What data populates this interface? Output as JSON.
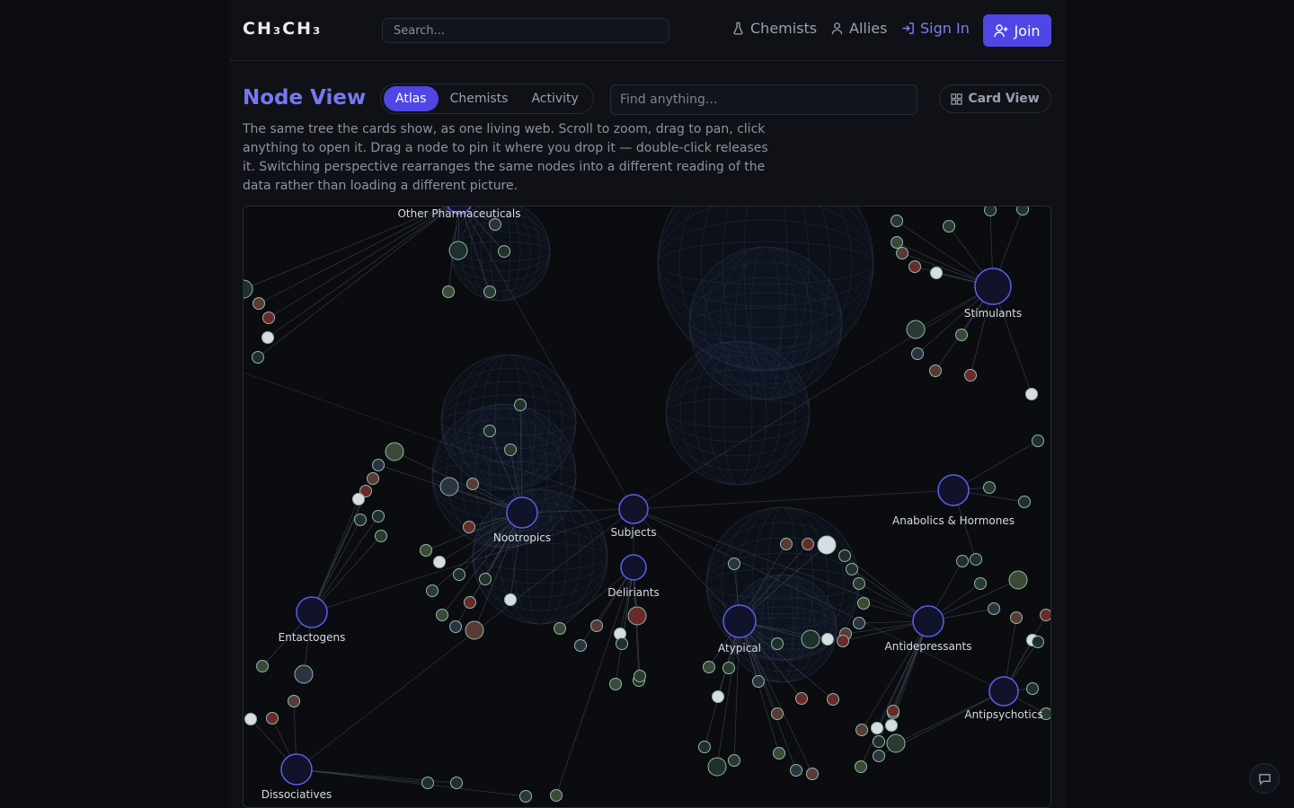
{
  "header": {
    "logo": "CH₃CH₃",
    "search_placeholder": "Search...",
    "nav": {
      "chemists": "Chemists",
      "allies": "Allies",
      "sign_in": "Sign In",
      "join": "Join"
    }
  },
  "page": {
    "title": "Node View",
    "tabs": [
      {
        "label": "Atlas",
        "active": true
      },
      {
        "label": "Chemists",
        "active": false
      },
      {
        "label": "Activity",
        "active": false
      }
    ],
    "find_placeholder": "Find anything...",
    "card_view_label": "Card View",
    "description": "The same tree the cards show, as one living web. Scroll to zoom, drag to pan, click anything to open it. Drag a node to pin it where you drop it — double-click releases it. Switching perspective rearranges the same nodes into a different reading of the data rather than loading a different picture."
  },
  "graph": {
    "colors": {
      "hub_ring": "#5b5ff0",
      "leaf_ring": "#8fb8a8",
      "edge": "#4a4f5e",
      "accent": "#7577f2"
    },
    "hubs": [
      {
        "label": "Other Pharmaceuticals"
      },
      {
        "label": "Stimulants"
      },
      {
        "label": "Anabolics & Hormones"
      },
      {
        "label": "Nootropics"
      },
      {
        "label": "Subjects"
      },
      {
        "label": "Deliriants"
      },
      {
        "label": "Entactogens"
      },
      {
        "label": "Atypical"
      },
      {
        "label": "Antidepressants"
      },
      {
        "label": "Antipsychotics"
      },
      {
        "label": "Dissociatives"
      }
    ]
  }
}
